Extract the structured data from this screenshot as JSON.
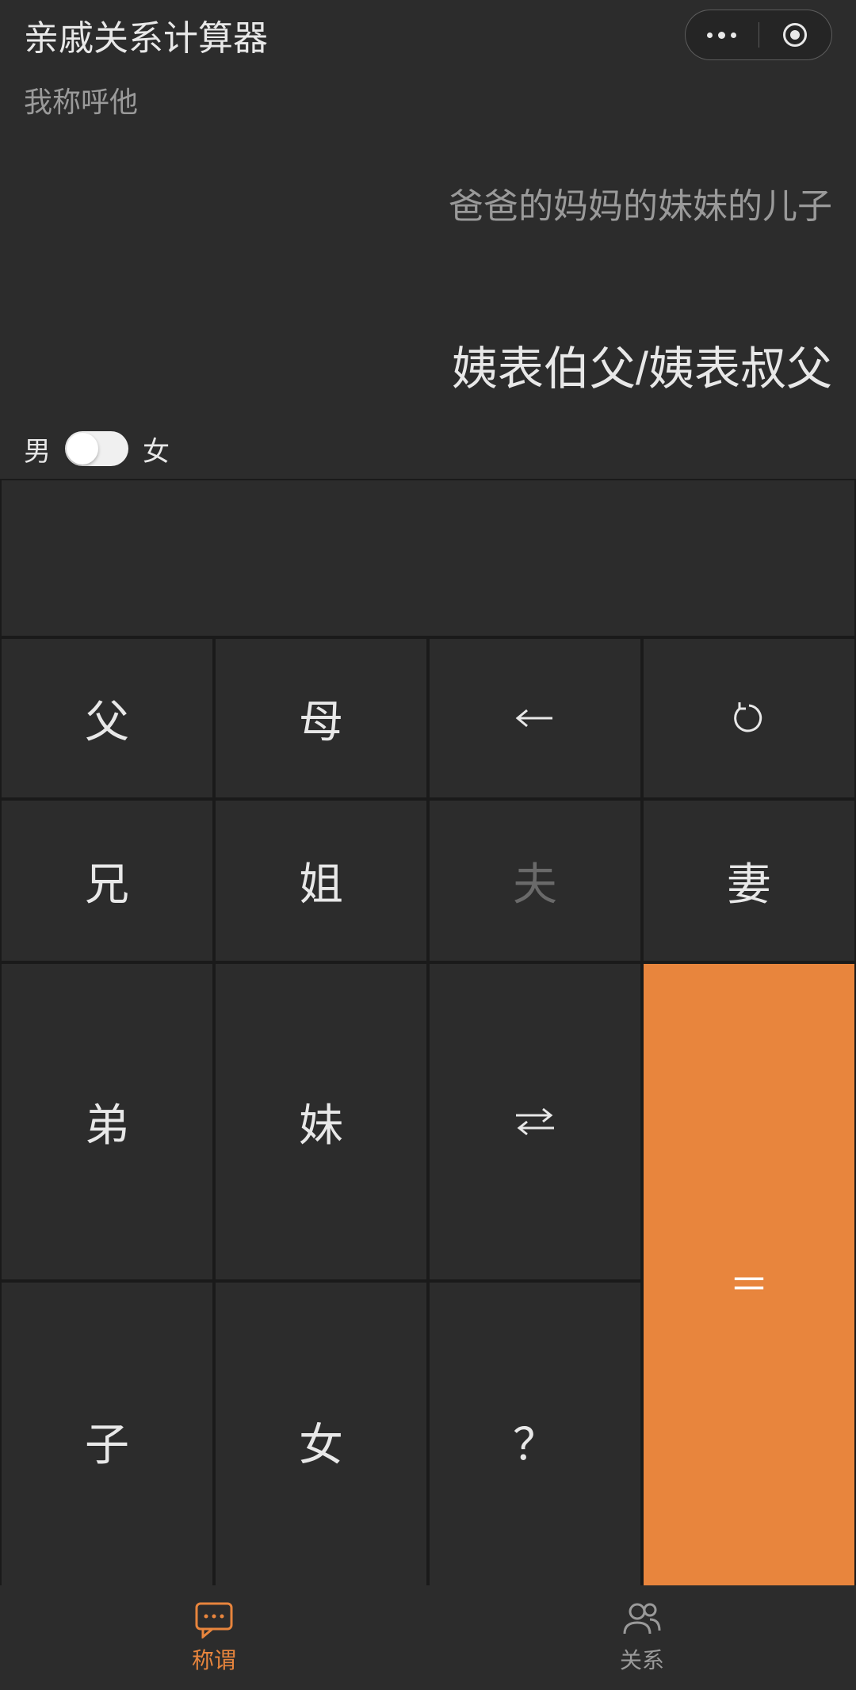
{
  "app": {
    "title": "亲戚关系计算器"
  },
  "subtitle": "我称呼他",
  "input_chain": "爸爸的妈妈的妹妹的儿子",
  "result": "姨表伯父/姨表叔父",
  "gender": {
    "male": "男",
    "female": "女"
  },
  "keys": {
    "father": "父",
    "mother": "母",
    "elder_brother": "兄",
    "elder_sister": "姐",
    "husband": "夫",
    "wife": "妻",
    "younger_brother": "弟",
    "younger_sister": "妹",
    "son": "子",
    "daughter": "女",
    "equals": "＝",
    "question": "？"
  },
  "tabs": {
    "title": "称谓",
    "relation": "关系"
  },
  "colors": {
    "accent": "#e8853d"
  }
}
